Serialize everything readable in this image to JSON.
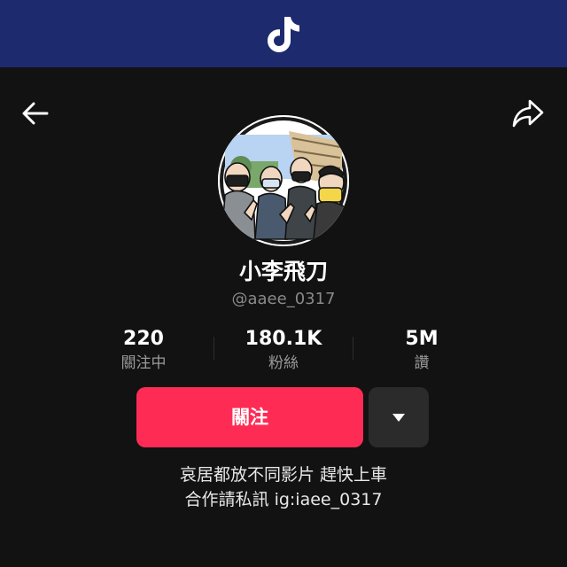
{
  "app": {
    "logo_icon": "tiktok-logo-icon",
    "header_color": "#1d2a6e",
    "accent_color": "#fe2c55"
  },
  "nav": {
    "back_icon": "arrow-left-icon",
    "share_icon": "share-arrow-icon"
  },
  "profile": {
    "display_name": "小李飛刀",
    "handle": "@aaee_0317",
    "avatar_icon": "avatar-illustration"
  },
  "stats": [
    {
      "value": "220",
      "label": "關注中"
    },
    {
      "value": "180.1K",
      "label": "粉絲"
    },
    {
      "value": "5M",
      "label": "讚"
    }
  ],
  "actions": {
    "follow_label": "關注",
    "more_icon": "caret-down-icon"
  },
  "bio": {
    "line1": "哀居都放不同影片 趕快上車",
    "line2": "合作請私訊 ig:iaee_0317"
  }
}
